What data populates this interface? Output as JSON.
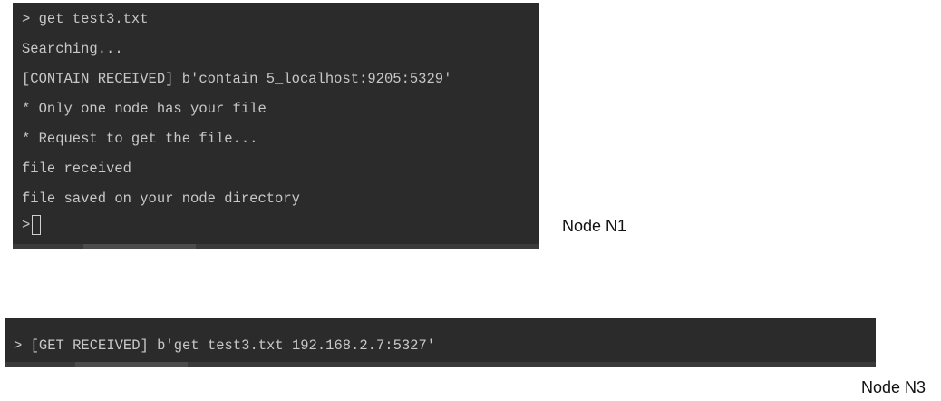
{
  "terminal_n1": {
    "lines": [
      "> get test3.txt",
      "Searching...",
      "[CONTAIN RECEIVED] b'contain 5_localhost:9205:5329'",
      "* Only one node has your file",
      "* Request to get the file...",
      "file received",
      "file saved on your node directory"
    ],
    "prompt": ">"
  },
  "terminal_n3": {
    "lines": [
      "> [GET RECEIVED] b'get test3.txt 192.168.2.7:5327'"
    ]
  },
  "labels": {
    "node_n1": "Node N1",
    "node_n3": "Node N3"
  },
  "colors": {
    "terminal_bg": "#2b2b2b",
    "terminal_text": "#c8c8c8",
    "page_bg": "#ffffff"
  }
}
